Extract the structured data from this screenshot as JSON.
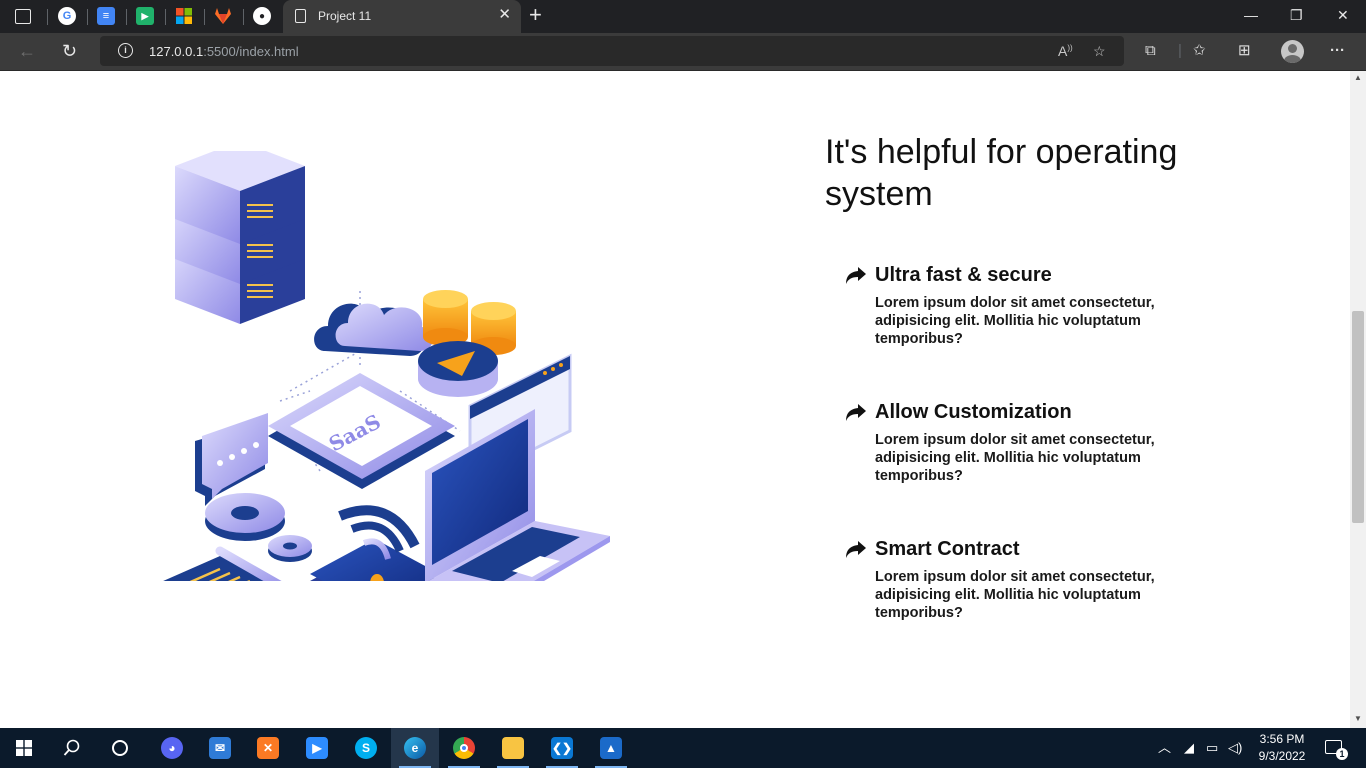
{
  "browser": {
    "pinned_tabs": [
      {
        "name": "tab-icon-window",
        "color": "#202124",
        "glyph": "▢"
      },
      {
        "name": "tab-icon-google",
        "color": "#ffffff",
        "glyph": "G"
      },
      {
        "name": "tab-icon-google-docs",
        "color": "#4285f4",
        "glyph": "≡"
      },
      {
        "name": "tab-icon-play",
        "color": "#20b26b",
        "glyph": "▶"
      },
      {
        "name": "tab-icon-microsoft",
        "color": "#ffffff",
        "glyph": ""
      },
      {
        "name": "tab-icon-gitlab",
        "color": "#fc6d26",
        "glyph": "◆"
      },
      {
        "name": "tab-icon-github",
        "color": "#ffffff",
        "glyph": "●"
      }
    ],
    "active_tab_title": "Project 11",
    "url_host": "127.0.0.1",
    "url_rest": ":5500/index.html",
    "window_controls": {
      "minimize": "—",
      "restore": "❐",
      "close": "✕"
    }
  },
  "page": {
    "heading": "It's helpful for operating system",
    "features": [
      {
        "title": "Ultra fast & secure",
        "description": "Lorem ipsum dolor sit amet consectetur, adipisicing elit. Mollitia hic voluptatum temporibus?"
      },
      {
        "title": "Allow Customization",
        "description": "Lorem ipsum dolor sit amet consectetur, adipisicing elit. Mollitia hic voluptatum temporibus?"
      },
      {
        "title": "Smart Contract",
        "description": "Lorem ipsum dolor sit amet consectetur, adipisicing elit. Mollitia hic voluptatum temporibus?"
      }
    ],
    "illustration": {
      "chip_label": "SaaS"
    }
  },
  "taskbar": {
    "clock_time": "3:56 PM",
    "clock_date": "9/3/2022",
    "notification_count": "1",
    "apps": [
      "discord",
      "mail",
      "xampp",
      "zoom",
      "skype",
      "edge",
      "chrome",
      "file-explorer",
      "vscode",
      "photos"
    ]
  },
  "colors": {
    "accent_navy": "#1c3e8f",
    "lavender": "#a8a4f0",
    "orange": "#f7a21b"
  }
}
